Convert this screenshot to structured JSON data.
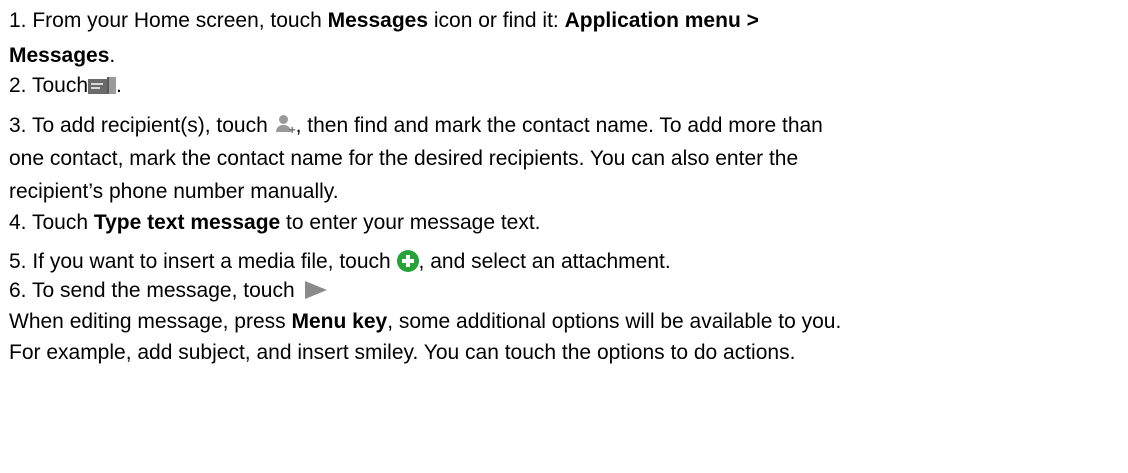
{
  "steps": {
    "s1": {
      "a": "1. From your Home screen, touch ",
      "b1": "Messages",
      "c": " icon or find it: ",
      "b2": "Application menu >",
      "b3": "Messages",
      "d": "."
    },
    "s2": {
      "a": "2. Touch",
      "icon": "compose-message-icon",
      "d": "."
    },
    "s3": {
      "a": "3. To add recipient(s), touch ",
      "icon": "add-contact-icon",
      "b": ", then find and mark the contact name. To add more than",
      "l2": "one contact, mark the contact name for the desired recipients. You can also enter the",
      "l3": "recipient’s phone number manually."
    },
    "s4": {
      "a": "4. Touch ",
      "b1": "Type text message",
      "c": " to enter your message text."
    },
    "s5": {
      "a": "5. If you want to insert a media file, touch ",
      "icon": "attach-icon",
      "b": ", and select an attachment."
    },
    "s6": {
      "a": "6. To send the message, touch",
      "icon": "send-icon"
    }
  },
  "note": {
    "a": "When editing message, press ",
    "b1": "Menu key",
    "c": ", some additional options will be available to you.",
    "l2": "For example, add subject, and insert smiley. You can touch the options to do actions."
  },
  "colors": {
    "text": "#000000",
    "attach_icon": "#27a33a",
    "icon_gray": "#8a8a8a"
  }
}
